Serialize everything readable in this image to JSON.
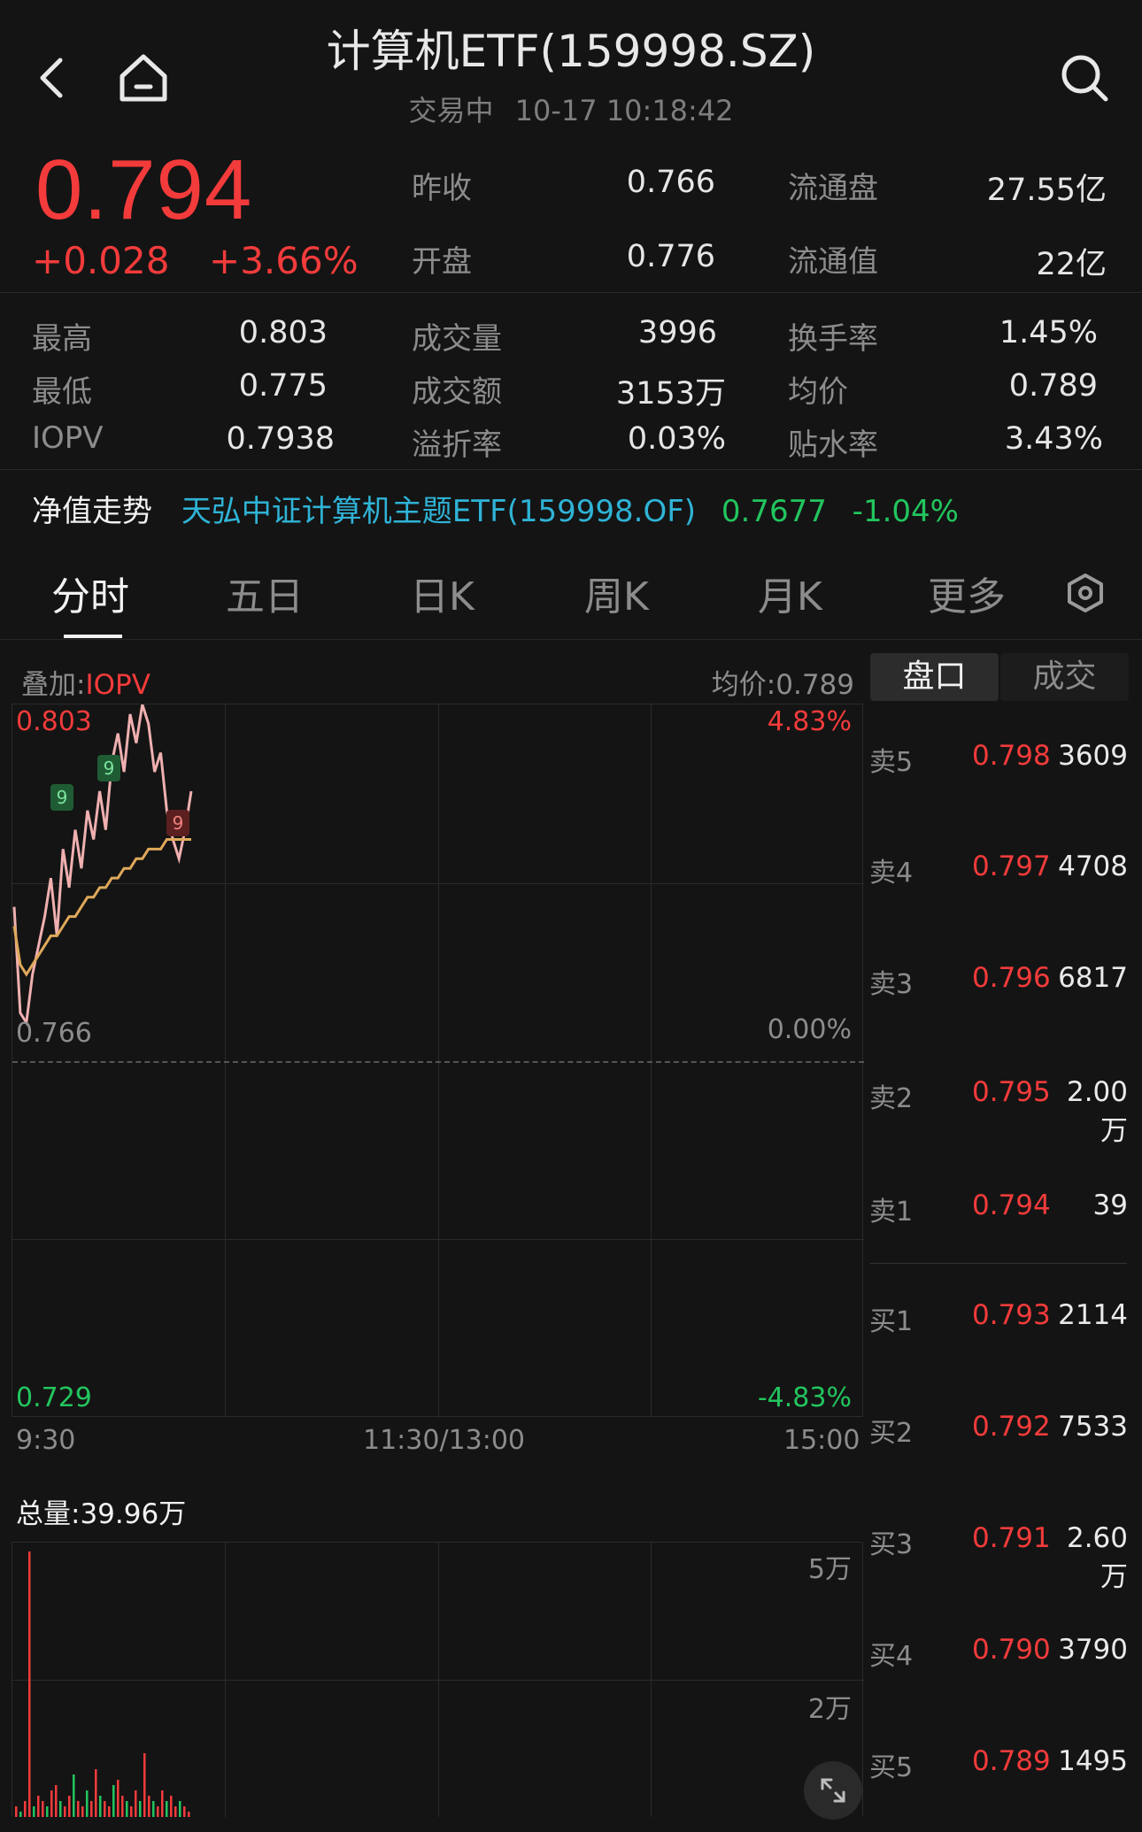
{
  "header": {
    "title": "计算机ETF(159998.SZ)",
    "status": "交易中",
    "datetime": "10-17 10:18:42"
  },
  "quote": {
    "price": "0.794",
    "change": "+0.028",
    "change_pct": "+3.66%",
    "stats": [
      {
        "label": "昨收",
        "value": "0.766"
      },
      {
        "label": "流通盘",
        "value": "27.55亿"
      },
      {
        "label": "开盘",
        "value": "0.776"
      },
      {
        "label": "流通值",
        "value": "22亿"
      },
      {
        "label": "最高",
        "value": "0.803"
      },
      {
        "label": "成交量",
        "value": "3996"
      },
      {
        "label": "换手率",
        "value": "1.45%"
      },
      {
        "label": "最低",
        "value": "0.775"
      },
      {
        "label": "成交额",
        "value": "3153万"
      },
      {
        "label": "均价",
        "value": "0.789"
      },
      {
        "label": "IOPV",
        "value": "0.7938"
      },
      {
        "label": "溢折率",
        "value": "0.03%"
      },
      {
        "label": "贴水率",
        "value": "3.43%"
      }
    ]
  },
  "nav": {
    "label": "净值走势",
    "fund_name": "天弘中证计算机主题ETF(159998.OF)",
    "value": "0.7677",
    "change_pct": "-1.04%"
  },
  "tabs": [
    "分时",
    "五日",
    "日K",
    "周K",
    "月K",
    "更多"
  ],
  "chart": {
    "overlay_label": "叠加:",
    "overlay_value": "IOPV",
    "avg_label": "均价:0.789",
    "y_top": "0.803",
    "y_mid": "0.766",
    "y_bottom": "0.729",
    "pct_top": "4.83%",
    "pct_mid": "0.00%",
    "pct_bottom": "-4.83%",
    "x_labels": [
      "9:30",
      "11:30/13:00",
      "15:00"
    ],
    "volume_total": "总量:39.96万",
    "vol_tick_high": "5万",
    "vol_tick_low": "2万",
    "markers": [
      "9",
      "9",
      "9"
    ]
  },
  "chart_data": {
    "type": "line",
    "x_range": [
      "9:30",
      "15:00"
    ],
    "ylim": [
      0.729,
      0.803
    ],
    "series": [
      {
        "values": [
          0.782,
          0.771,
          0.77,
          0.775,
          0.778,
          0.781,
          0.785,
          0.779,
          0.788,
          0.784,
          0.79,
          0.786,
          0.792,
          0.789,
          0.794,
          0.79,
          0.797,
          0.8,
          0.796,
          0.802,
          0.799,
          0.803,
          0.801,
          0.796,
          0.798,
          0.792,
          0.789,
          0.787,
          0.79,
          0.794
        ]
      },
      {
        "values": [
          0.78,
          0.776,
          0.775,
          0.776,
          0.777,
          0.778,
          0.779,
          0.779,
          0.78,
          0.781,
          0.781,
          0.782,
          0.783,
          0.783,
          0.784,
          0.784,
          0.785,
          0.785,
          0.786,
          0.786,
          0.787,
          0.787,
          0.788,
          0.788,
          0.788,
          0.789,
          0.789,
          0.789,
          0.789,
          0.789
        ]
      }
    ],
    "volume": [
      2,
      1,
      3,
      50,
      2,
      4,
      3,
      2,
      5,
      6,
      3,
      2,
      4,
      8,
      3,
      2,
      5,
      3,
      9,
      4,
      3,
      2,
      6,
      7,
      4,
      3,
      2,
      5,
      3,
      12,
      4,
      3,
      2,
      5,
      3,
      4,
      2,
      3,
      2,
      1
    ]
  },
  "orderbook": {
    "tabs": [
      "盘口",
      "成交"
    ],
    "sell": [
      {
        "label": "卖5",
        "price": "0.798",
        "vol": "3609"
      },
      {
        "label": "卖4",
        "price": "0.797",
        "vol": "4708"
      },
      {
        "label": "卖3",
        "price": "0.796",
        "vol": "6817"
      },
      {
        "label": "卖2",
        "price": "0.795",
        "vol": "2.00万"
      },
      {
        "label": "卖1",
        "price": "0.794",
        "vol": "39"
      }
    ],
    "buy": [
      {
        "label": "买1",
        "price": "0.793",
        "vol": "2114"
      },
      {
        "label": "买2",
        "price": "0.792",
        "vol": "7533"
      },
      {
        "label": "买3",
        "price": "0.791",
        "vol": "2.60万"
      },
      {
        "label": "买4",
        "price": "0.790",
        "vol": "3790"
      },
      {
        "label": "买5",
        "price": "0.789",
        "vol": "1495"
      }
    ]
  },
  "colors": {
    "up": "#f33b3b",
    "down": "#22c55e",
    "avg_line": "#e0a95a",
    "price_line": "#f0b0b0"
  }
}
